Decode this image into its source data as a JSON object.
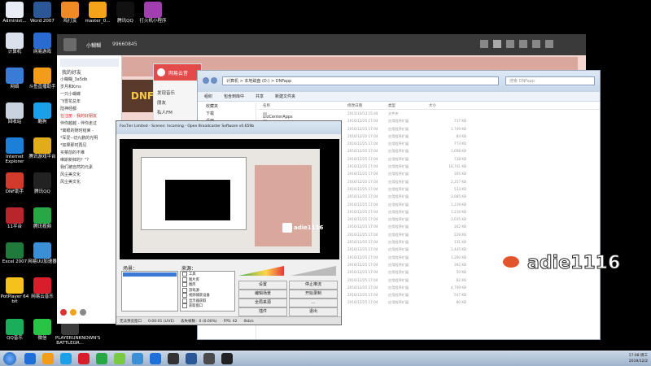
{
  "desktop": {
    "top_icons": [
      {
        "label": "Administ...",
        "color": "#e9edf3"
      },
      {
        "label": "Word 2007",
        "color": "#2b5797"
      },
      {
        "label": "鸡打赏",
        "color": "#f08a24"
      },
      {
        "label": "master_0...",
        "color": "#f3a21a"
      },
      {
        "label": "腾讯QQ",
        "color": "#111111"
      },
      {
        "label": "打火机小程序",
        "color": "#a13fb0"
      }
    ],
    "left_icons": [
      {
        "label": "计算机",
        "color": "#d9e2ec"
      },
      {
        "label": "网络",
        "color": "#3a7bd5"
      },
      {
        "label": "回收站",
        "color": "#c9d3df"
      },
      {
        "label": "Internet Explorer",
        "color": "#1c80d8"
      },
      {
        "label": "DNF助手",
        "color": "#d23b2b"
      },
      {
        "label": "11平台",
        "color": "#b8262b"
      },
      {
        "label": "Excel 2007",
        "color": "#1f7a3b"
      },
      {
        "label": "PotPlayer 64 bit",
        "color": "#f4c21a"
      }
    ],
    "second_col_icons": [
      {
        "label": "网易游戏",
        "color": "#2a6bd1"
      },
      {
        "label": "斗鱼直播助手",
        "color": "#f39c1a"
      },
      {
        "label": "酷狗",
        "color": "#1aa0e8"
      },
      {
        "label": "腾讯游戏平台",
        "color": "#e0ac1a"
      },
      {
        "label": "腾讯QQ",
        "color": "#222222"
      },
      {
        "label": "腾讯视频",
        "color": "#28a745"
      },
      {
        "label": "网易UU加速器",
        "color": "#3a8fd6"
      },
      {
        "label": "网易云音乐",
        "color": "#d81e2b"
      }
    ],
    "bottom_icons": [
      {
        "label": "QQ音乐",
        "color": "#1aad5a"
      },
      {
        "label": "微信",
        "color": "#28c445"
      },
      {
        "label": "PLAYERUNKNOWN'S BATTLEGR...",
        "color": "#3b3b3b"
      }
    ]
  },
  "qq_panel": {
    "title": "小糊糊",
    "id": "99660845",
    "group_header": "我的好友",
    "items": [
      "小糊糊_3a5db",
      "岁月和Kms",
      "一只小蝴蝶",
      "飞雪花总年",
      "陆神经都",
      "在注册 - 我的好朋友",
      "伴你越越 - 伴你走过",
      "*离眼的随时结束 - ",
      "*军爱--切九鹏的光明",
      "*如果那时再见",
      "买菜前的不难",
      "维斯新鲜的？\"?",
      "我们被自然的元素",
      "风尘美文化",
      "风尘美文化"
    ]
  },
  "game_client": {
    "title": "小糊糊",
    "id": "99660845",
    "banner_text": "DNF"
  },
  "netease": {
    "brand": "网易云音",
    "menu": [
      "发现音乐",
      "朋友",
      "私人FM"
    ]
  },
  "explorer": {
    "breadcrumb": "计算机 > 本地磁盘 (D:) > DNFapp",
    "search_placeholder": "搜索 DNFapp",
    "toolbar": [
      "组织",
      "包含到库中",
      "共享",
      "新建文件夹"
    ],
    "nav": [
      "收藏夹",
      "下载",
      "桌面",
      "最近访问的位置",
      "库"
    ],
    "columns": [
      "名称",
      "修改日期",
      "类型",
      "大小"
    ],
    "first_file": "BizCenterApps",
    "rows": [
      {
        "date": "2015/10/13 15:44",
        "type": "文件夹",
        "size": ""
      },
      {
        "date": "2016/12/25 17:04",
        "type": "应用程序扩展",
        "size": "717 KB"
      },
      {
        "date": "2016/12/25 17:04",
        "type": "应用程序扩展",
        "size": "1,749 KB"
      },
      {
        "date": "2016/12/25 17:04",
        "type": "应用程序扩展",
        "size": "84 KB"
      },
      {
        "date": "2016/12/25 17:04",
        "type": "应用程序扩展",
        "size": "773 KB"
      },
      {
        "date": "2016/12/25 17:04",
        "type": "应用程序扩展",
        "size": "1,008 KB"
      },
      {
        "date": "2016/12/25 17:04",
        "type": "应用程序扩展",
        "size": "738 KB"
      },
      {
        "date": "2016/12/25 17:04",
        "type": "应用程序扩展",
        "size": "16,741 KB"
      },
      {
        "date": "2016/12/25 17:04",
        "type": "应用程序扩展",
        "size": "305 KB"
      },
      {
        "date": "2016/12/25 17:04",
        "type": "应用程序扩展",
        "size": "2,257 KB"
      },
      {
        "date": "2016/12/25 17:04",
        "type": "应用程序扩展",
        "size": "533 KB"
      },
      {
        "date": "2016/12/25 17:04",
        "type": "应用程序扩展",
        "size": "3,085 KB"
      },
      {
        "date": "2016/12/25 17:04",
        "type": "应用程序扩展",
        "size": "1,219 KB"
      },
      {
        "date": "2016/12/25 17:04",
        "type": "应用程序扩展",
        "size": "1,216 KB"
      },
      {
        "date": "2016/12/25 17:04",
        "type": "应用程序扩展",
        "size": "3,035 KB"
      },
      {
        "date": "2016/12/25 17:04",
        "type": "应用程序扩展",
        "size": "162 KB"
      },
      {
        "date": "2016/12/25 17:04",
        "type": "应用程序扩展",
        "size": "229 KB"
      },
      {
        "date": "2016/12/25 17:04",
        "type": "应用程序扩展",
        "size": "131 KB"
      },
      {
        "date": "2016/12/25 17:04",
        "type": "应用程序扩展",
        "size": "1,445 KB"
      },
      {
        "date": "2016/12/25 17:04",
        "type": "应用程序扩展",
        "size": "1,260 KB"
      },
      {
        "date": "2016/12/25 17:04",
        "type": "应用程序扩展",
        "size": "392 KB"
      },
      {
        "date": "2016/12/25 17:04",
        "type": "应用程序扩展",
        "size": "50 KB"
      },
      {
        "date": "2016/12/25 17:04",
        "type": "应用程序扩展",
        "size": "82 KB"
      },
      {
        "date": "2016/12/25 17:04",
        "type": "应用程序扩展",
        "size": "4,709 KB"
      },
      {
        "date": "2016/12/25 17:04",
        "type": "应用程序扩展",
        "size": "547 KB"
      },
      {
        "date": "2016/12/25 17:04",
        "type": "应用程序扩展",
        "size": "80 KB"
      }
    ]
  },
  "obs": {
    "title": "FooTier Limited - Scenes: Incoming - Open Broadcaster Software v0.659b",
    "scenes_label": "场景：",
    "sources_label": "来源：",
    "sources": [
      "工具",
      "图片库",
      "图库",
      "游戏源",
      "视频捕获设备",
      "显示器获取",
      "获取窗口"
    ],
    "buttons": [
      {
        "name": "settings",
        "label": "设置"
      },
      {
        "name": "stop-preview",
        "label": "停止推流"
      },
      {
        "name": "edit-scene",
        "label": "编辑场景"
      },
      {
        "name": "start-record",
        "label": "开始录制"
      },
      {
        "name": "global-sources",
        "label": "全局来源"
      },
      {
        "name": "hotkeys",
        "label": "..."
      },
      {
        "name": "plugins",
        "label": "插件"
      },
      {
        "name": "exit",
        "label": "退出"
      }
    ],
    "status": {
      "preview": "无法预览窗口",
      "time": "0:00:01 (LIVE)",
      "dropped": "丢失帧数：0 (0.00%)",
      "fps": "FPS: 42",
      "bitrate": "0kb/s"
    }
  },
  "watermark": {
    "text": "adie1116",
    "small_text": "adie1116"
  },
  "taskbar": {
    "time": "17:08 周三",
    "date": "2019/12/2",
    "apps": [
      "#1e6fd9",
      "#f39c1a",
      "#1aa0e8",
      "#d81e2b",
      "#28a745",
      "#7ac943",
      "#3a8fd6",
      "#1e6fd9",
      "#333333",
      "#2b5797",
      "#4a4a4a",
      "#222222"
    ]
  }
}
